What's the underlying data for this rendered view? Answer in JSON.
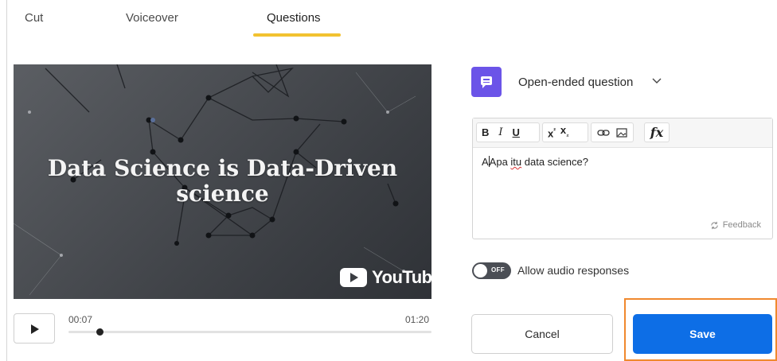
{
  "tabs": [
    {
      "label": "Cut"
    },
    {
      "label": "Voiceover"
    },
    {
      "label": "Questions",
      "active": true
    }
  ],
  "accent": {
    "tab_underline": "#f2c230",
    "question_icon": "#6b54e8",
    "save": "#0d6ee6",
    "highlight": "#f0892e"
  },
  "video": {
    "title_line1": "Data Science is Data-Driven",
    "title_line2": "science",
    "platform": "YouTube"
  },
  "player": {
    "current_time": "00:07",
    "total_time": "01:20",
    "progress_fraction": 0.0875,
    "play_icon": "play-icon"
  },
  "question": {
    "type_label": "Open-ended question",
    "type_icon": "chat-bubble-icon",
    "toolbar": [
      "B",
      "I",
      "U",
      "x²",
      "x₂",
      "link",
      "image",
      "fx"
    ],
    "text_prefix": "Apa ",
    "text_misspelled": "itu",
    "text_suffix": " data science?",
    "feedback_label": "Feedback"
  },
  "audio_toggle": {
    "state": "OFF",
    "label": "Allow audio responses"
  },
  "buttons": {
    "cancel": "Cancel",
    "save": "Save"
  }
}
